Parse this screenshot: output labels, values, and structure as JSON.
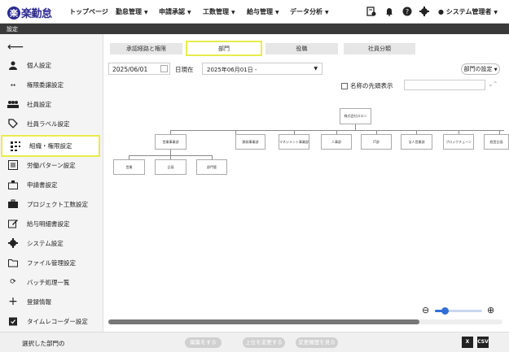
{
  "app": {
    "logo_mark": "楽",
    "logo_text": "楽勤怠"
  },
  "topnav": {
    "menus": [
      {
        "label": "トップページ"
      },
      {
        "label": "勤怠管理"
      },
      {
        "label": "申請承認"
      },
      {
        "label": "工数管理"
      },
      {
        "label": "給与管理"
      },
      {
        "label": "データ分析"
      }
    ],
    "icons": [
      "schedule-icon",
      "bell-icon",
      "help-icon",
      "gear-icon",
      "user-icon"
    ],
    "user_label": "システム管理者"
  },
  "breadcrumb": {
    "label": "設定"
  },
  "sidebar": {
    "back_icon": "arrow-left-icon",
    "items": [
      {
        "label": "個人設定",
        "icon": "person-icon"
      },
      {
        "label": "権限委譲設定",
        "icon": "transfer-icon"
      },
      {
        "label": "社員設定",
        "icon": "group-icon"
      },
      {
        "label": "社員ラベル設定",
        "icon": "tag-icon"
      },
      {
        "label": "組織・権限設定",
        "icon": "org-icon",
        "active": true
      },
      {
        "label": "労働パターン設定",
        "icon": "list-icon"
      },
      {
        "label": "申請書設定",
        "icon": "inbox-icon"
      },
      {
        "label": "プロジェクト工数設定",
        "icon": "briefcase-icon"
      },
      {
        "label": "給与明細書設定",
        "icon": "edit-doc-icon"
      },
      {
        "label": "システム設定",
        "icon": "gear-icon"
      },
      {
        "label": "ファイル管理設定",
        "icon": "folder-icon"
      },
      {
        "label": "バッチ処理一覧",
        "icon": "batch-icon"
      },
      {
        "label": "登録情報",
        "icon": "plus-icon"
      },
      {
        "label": "タイムレコーダー設定",
        "icon": "clipboard-icon"
      }
    ]
  },
  "tabs": [
    {
      "label": "承認経路と権限"
    },
    {
      "label": "部門",
      "active": true
    },
    {
      "label": "役職"
    },
    {
      "label": "社員分類"
    }
  ],
  "filters": {
    "date_value": "2025/06/01",
    "as_of_label": "日現在",
    "select_value": "2025年06月01日 -",
    "dept_settings_label": "部門の設定",
    "show_name_head_label": "名称の先頭表示",
    "search_value": ""
  },
  "org_chart": {
    "root": "株式会社ロロン",
    "level1": [
      "営業事業部",
      "開発事業部",
      "マネジメント事業部",
      "人事部",
      "IT部",
      "法人営業部",
      "ブロックチェーン",
      "経営企画"
    ],
    "level2": [
      "営業",
      "企画",
      "部門管"
    ]
  },
  "zoom": {
    "level": 0.2
  },
  "footer": {
    "selected_label": "選択した部門の",
    "buttons": [
      {
        "label": "編集をする"
      },
      {
        "label": "上位を変更する"
      },
      {
        "label": "変更履歴を見る"
      }
    ],
    "exports": [
      {
        "label": "X"
      },
      {
        "label": "CSV"
      }
    ]
  }
}
